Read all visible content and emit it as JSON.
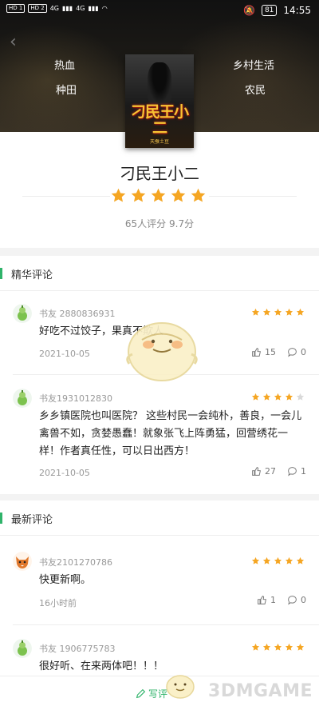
{
  "status_bar": {
    "left_chips": [
      "HD 1",
      "HD 2"
    ],
    "signal": "4G",
    "signal2": "4G",
    "battery": "81",
    "time": "14:55"
  },
  "book": {
    "tags": [
      "热血",
      "种田",
      "乡村生活",
      "农民"
    ],
    "cover_title": "刁民王小二",
    "cover_author": "天蚕土豆",
    "title": "刁民王小二",
    "stars": 5,
    "rating_text": "65人评分 9.7分"
  },
  "featured": {
    "heading": "精华评论",
    "comments": [
      {
        "user": "书友 2880836931",
        "stars": 5,
        "text": "好吃不过饺子，果真不欺人",
        "date": "2021-10-05",
        "likes": "15",
        "replies": "0"
      },
      {
        "user": "书友1931012830",
        "stars": 4,
        "text": "乡乡镇医院也叫医院？ 这些村民一会纯朴，善良，一会儿禽兽不如，贪婪愚蠢！就象张飞上阵勇猛，回营绣花一样！作者真任性，可以日出西方！",
        "date": "2021-10-05",
        "likes": "27",
        "replies": "1"
      }
    ]
  },
  "latest": {
    "heading": "最新评论",
    "comments": [
      {
        "user": "书友2101270786",
        "stars": 5,
        "text": "快更新啊。",
        "date": "16小时前",
        "likes": "1",
        "replies": "0"
      },
      {
        "user": "书友 1906775783",
        "stars": 5,
        "text": "很好听、在来两体吧！！！",
        "date": "",
        "likes": "",
        "replies": ""
      }
    ]
  },
  "bottom": {
    "write_label": "写评",
    "watermark": "3DMGAME"
  },
  "colors": {
    "accent": "#2fb36a",
    "star": "#f5a623",
    "star_off": "#d9d9d9"
  },
  "icons": [
    "back-icon",
    "star-icon",
    "thumb-up-icon",
    "comment-icon",
    "edit-icon",
    "avatar-gourd-icon",
    "avatar-fox-icon",
    "mascot"
  ]
}
